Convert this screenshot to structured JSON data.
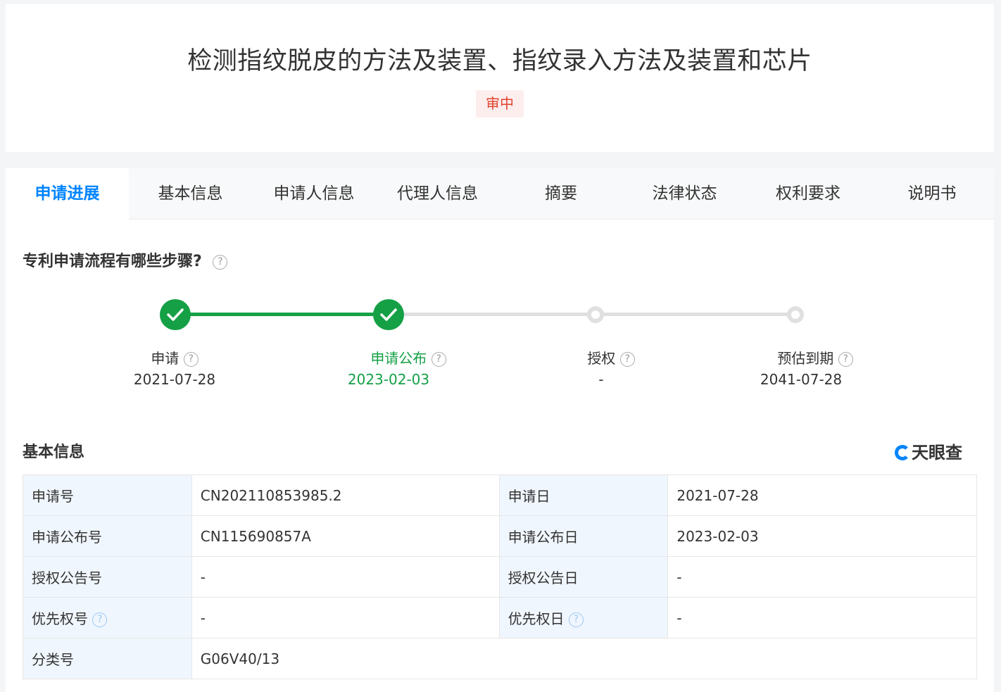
{
  "title": "检测指纹脱皮的方法及装置、指纹录入方法及装置和芯片",
  "status": "审中",
  "tabs": [
    "申请进展",
    "基本信息",
    "申请人信息",
    "代理人信息",
    "摘要",
    "法律状态",
    "权利要求",
    "说明书"
  ],
  "progress": {
    "heading": "专利申请流程有哪些步骤?",
    "steps": [
      {
        "label": "申请",
        "date": "2021-07-28",
        "done": true
      },
      {
        "label": "申请公布",
        "date": "2023-02-03",
        "done": true
      },
      {
        "label": "授权",
        "date": "-",
        "done": false
      },
      {
        "label": "预估到期",
        "date": "2041-07-28",
        "done": false
      }
    ]
  },
  "basic": {
    "heading": "基本信息",
    "brand": "天眼查",
    "rows": [
      [
        {
          "label": "申请号",
          "value": "CN202110853985.2"
        },
        {
          "label": "申请日",
          "value": "2021-07-28"
        }
      ],
      [
        {
          "label": "申请公布号",
          "value": "CN115690857A"
        },
        {
          "label": "申请公布日",
          "value": "2023-02-03"
        }
      ],
      [
        {
          "label": "授权公告号",
          "value": "-"
        },
        {
          "label": "授权公告日",
          "value": "-"
        }
      ],
      [
        {
          "label": "优先权号",
          "value": "-"
        },
        {
          "label": "优先权日",
          "value": "-"
        }
      ],
      [
        {
          "label": "分类号",
          "value": "G06V40/13"
        }
      ]
    ]
  },
  "colors": {
    "accent": "#0084ff",
    "done": "#15a046",
    "status": "#e0442e",
    "label_bg": "#f0f6fd"
  }
}
